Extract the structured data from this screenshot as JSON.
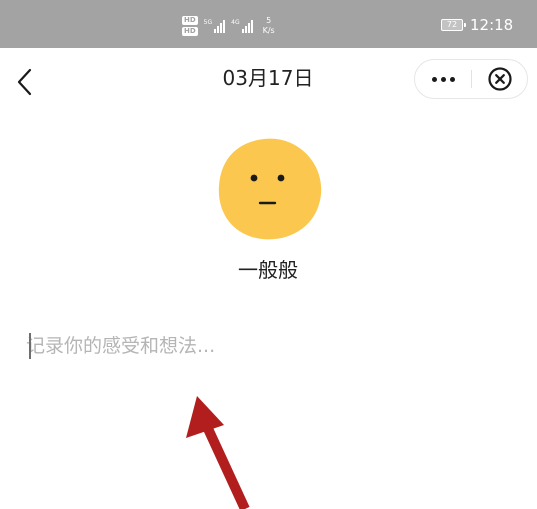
{
  "status_bar": {
    "hd_badge_1": "HD",
    "hd_badge_2": "HD",
    "signal_1_tag": "5G",
    "signal_2_tag": "4G",
    "speed_value": "5",
    "speed_unit": "K/s",
    "battery_level": "72",
    "time": "12:18"
  },
  "nav": {
    "title": "03月17日"
  },
  "mood": {
    "label": "一般般",
    "face_color": "#fbc74f",
    "feature_color": "#1a1a1a"
  },
  "note": {
    "value": "",
    "placeholder": "记录你的感受和想法..."
  },
  "annotation": {
    "arrow_color": "#b21e1e"
  },
  "icons": {
    "back": "chevron-left-icon",
    "more": "more-dots-icon",
    "close": "close-circle-icon"
  }
}
